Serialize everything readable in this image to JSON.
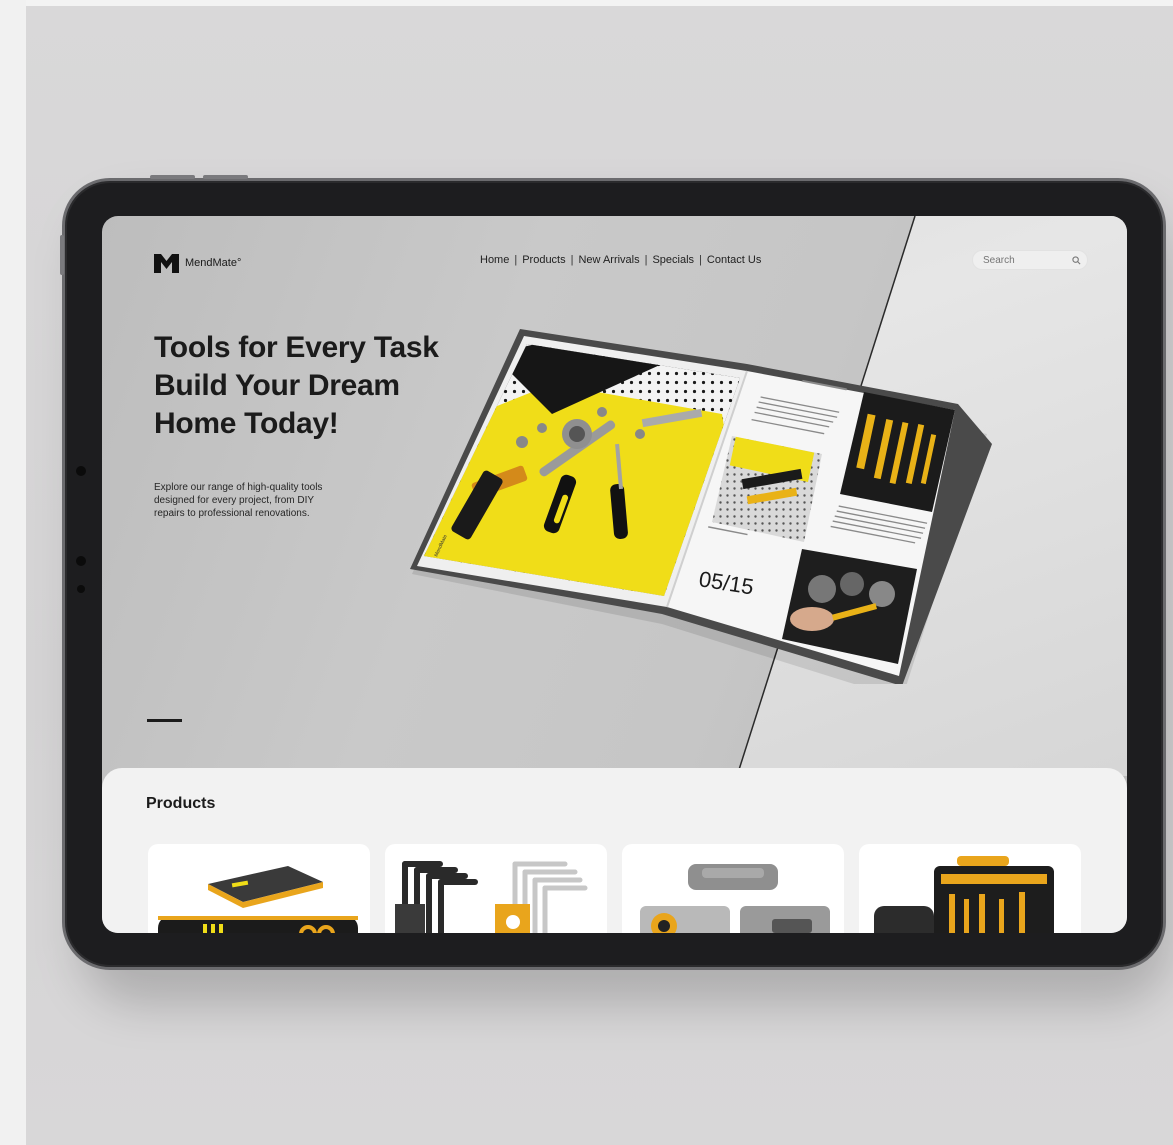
{
  "brand": {
    "name": "MendMate°"
  },
  "nav": {
    "items": [
      "Home",
      "Products",
      "New Arrivals",
      "Specials",
      "Contact Us"
    ],
    "separator": "|"
  },
  "search": {
    "placeholder": "Search"
  },
  "hero": {
    "title_lines": [
      "Tools for Every Task",
      "Build Your Dream",
      "Home Today!"
    ],
    "description": "Explore our range of high-quality tools designed for every project, from DIY repairs to professional renovations."
  },
  "magazine": {
    "page_number": "05/15"
  },
  "products": {
    "title": "Products",
    "cards": [
      "tool-kit-case",
      "hex-key-set",
      "tool-box-kit",
      "toolbox-set"
    ]
  },
  "colors": {
    "accent": "#f5e21b",
    "dark": "#1b1b1b",
    "panel": "#f2f2f2"
  }
}
